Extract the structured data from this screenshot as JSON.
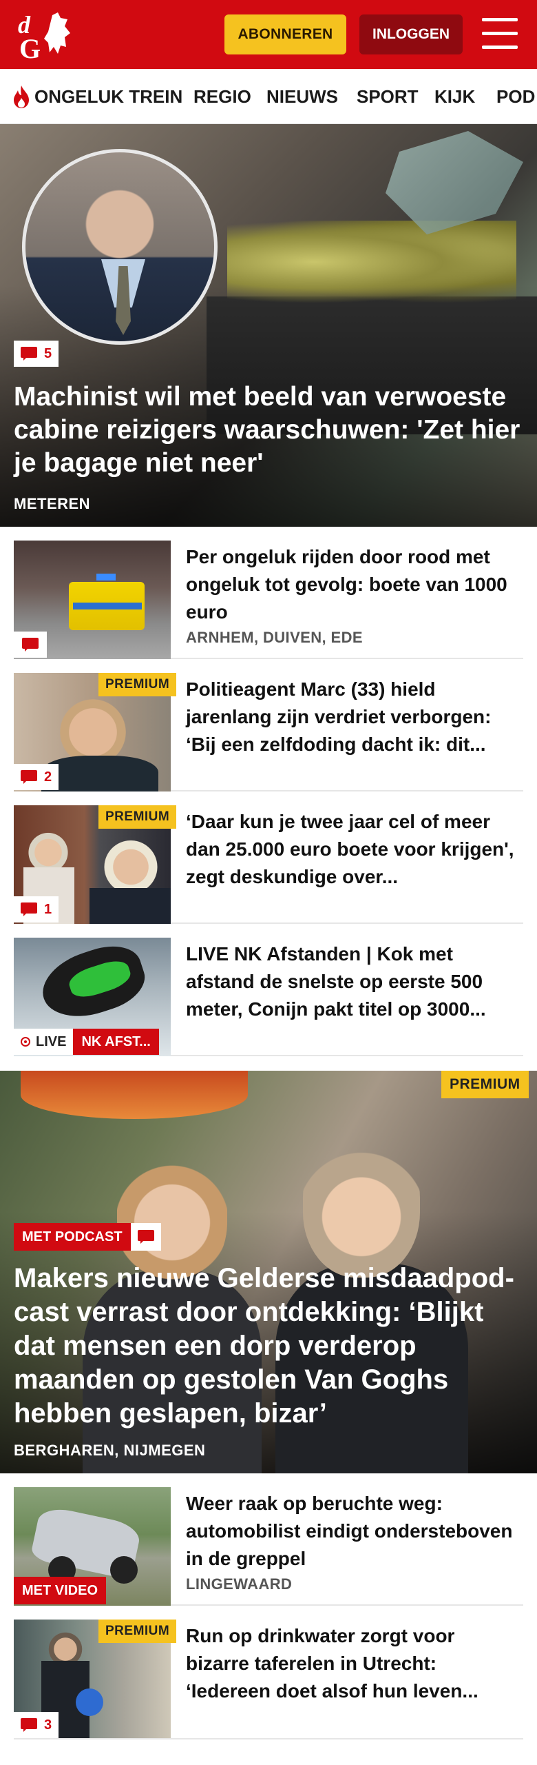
{
  "header": {
    "brand_colors": {
      "primary": "#d10a11",
      "accent": "#f5c21f"
    },
    "subscribe_label": "ABONNEREN",
    "login_label": "INLOGGEN",
    "menu_icon": "hamburger-menu-icon"
  },
  "nav": {
    "items": [
      {
        "label": "ONGELUK TREIN",
        "icon": "flame-icon"
      },
      {
        "label": "REGIO"
      },
      {
        "label": "NIEUWS"
      },
      {
        "label": "SPORT"
      },
      {
        "label": "KIJK"
      },
      {
        "label": "POD"
      }
    ]
  },
  "hero": {
    "comments": "5",
    "title": "Machinist wil met beeld van verwoeste cabine reizigers waarschu­wen: 'Zet hier je bagage niet neer'",
    "location": "METEREN"
  },
  "articles": [
    {
      "title": "Per ongeluk rijden door rood met ongeluk tot gevolg: boete van 1000 euro",
      "location": "ARNHEM, DUIVEN, EDE",
      "comments": ""
    },
    {
      "title": "Politieagent Marc (33) hield jarenlang zijn verdriet verborgen: ‘Bij een zelfdoding dacht ik: dit...",
      "premium": "PREMIUM",
      "comments": "2"
    },
    {
      "title": "‘Daar kun je twee jaar cel of meer dan 25.000 euro boete voor krijgen', zegt deskundige over...",
      "premium": "PREMIUM",
      "comments": "1"
    },
    {
      "title": "LIVE NK Afstanden | Kok met afstand de snelste op eerste 500 meter, Conijn pakt titel op 3000...",
      "live_label": "LIVE",
      "tag": "NK AFST..."
    }
  ],
  "hero2": {
    "premium": "PREMIUM",
    "tag": "MET PODCAST",
    "title": "Makers nieuwe Gelderse misdaadpod­cast verrast door ontdekking: ‘Blijkt dat mensen een dorp verderop maanden op gestolen Van Goghs hebben geslapen, bizar’",
    "location": "BERGHAREN, NIJMEGEN"
  },
  "articles2": [
    {
      "title": "Weer raak op beruchte weg: automobilist eindigt ondersteboven in de greppel",
      "location": "LINGEWAARD",
      "tag": "MET VIDEO"
    },
    {
      "title": "Run op drinkwater zorgt voor bizarre taferelen in Utrecht: ‘Iedereen doet alsof hun leven...",
      "premium": "PREMIUM",
      "comments": "3"
    }
  ]
}
